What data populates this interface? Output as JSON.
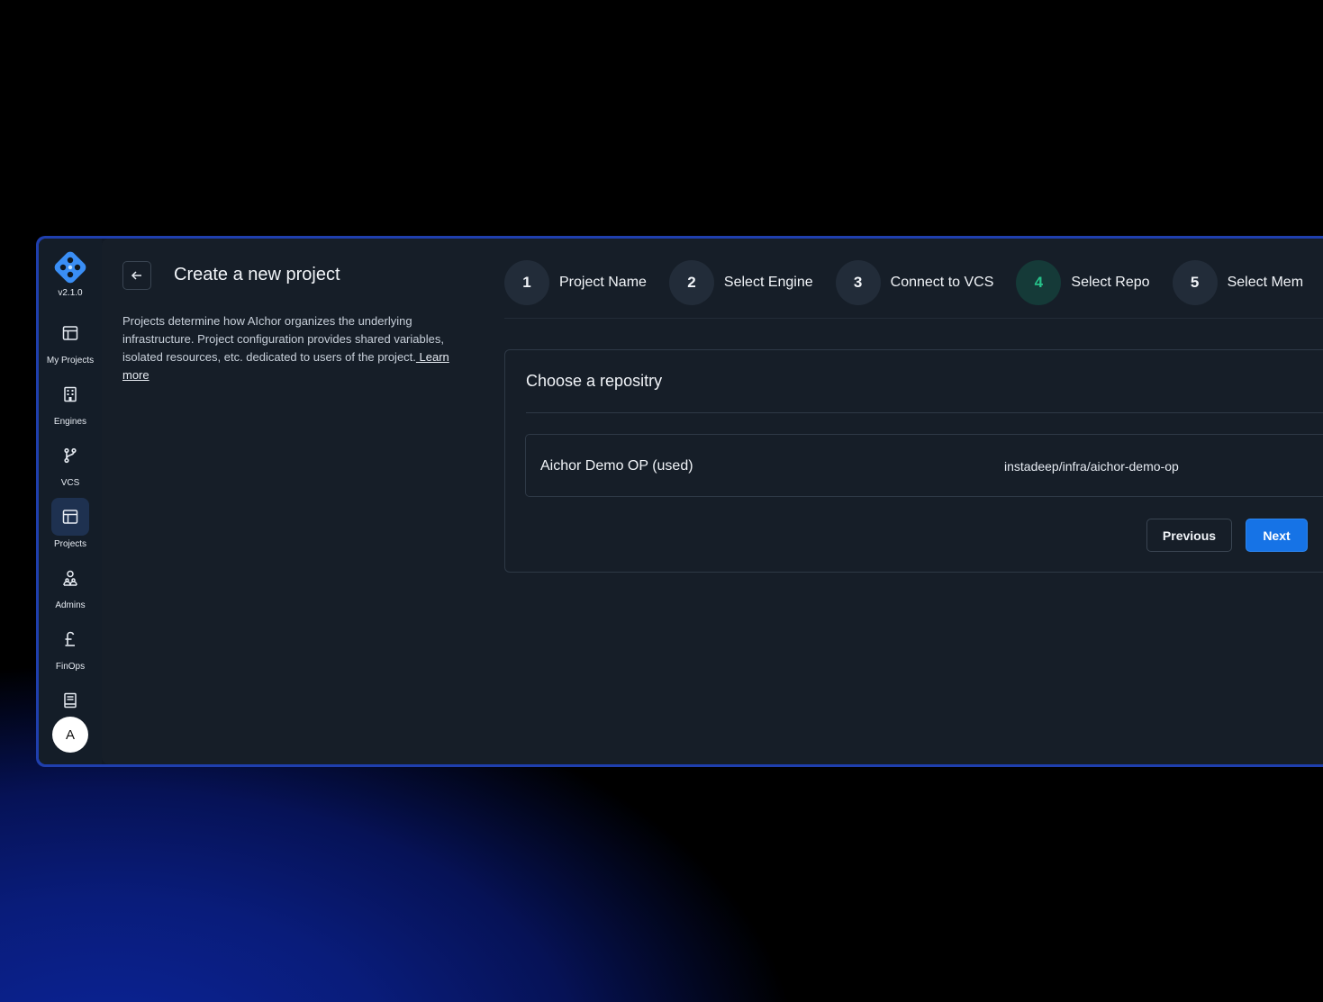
{
  "app": {
    "version": "v2.1.0"
  },
  "sidebar": {
    "items": [
      {
        "label": "My Projects",
        "icon": "layout-icon",
        "active": false
      },
      {
        "label": "Engines",
        "icon": "building-icon",
        "active": false
      },
      {
        "label": "VCS",
        "icon": "git-branch-icon",
        "active": false
      },
      {
        "label": "Projects",
        "icon": "layout-icon",
        "active": true
      },
      {
        "label": "Admins",
        "icon": "admins-icon",
        "active": false
      },
      {
        "label": "FinOps",
        "icon": "pound-icon",
        "active": false
      },
      {
        "label": "",
        "icon": "book-icon",
        "active": false
      }
    ],
    "avatar_initial": "A"
  },
  "header": {
    "title": "Create a new project",
    "description": "Projects determine how AIchor organizes the underlying infrastructure.  Project configuration provides shared variables, isolated resources,  etc. dedicated to users of the project.",
    "learn_more": " Learn more"
  },
  "stepper": {
    "steps": [
      {
        "number": "1",
        "label": "Project Name",
        "active": false
      },
      {
        "number": "2",
        "label": "Select Engine",
        "active": false
      },
      {
        "number": "3",
        "label": "Connect to VCS",
        "active": false
      },
      {
        "number": "4",
        "label": "Select Repo",
        "active": true
      },
      {
        "number": "5",
        "label": "Select Mem",
        "active": false
      }
    ]
  },
  "card": {
    "title": "Choose a repositry",
    "repos": [
      {
        "name": "Aichor Demo OP (used)",
        "path": "instadeep/infra/aichor-demo-op"
      }
    ],
    "previous_label": "Previous",
    "next_label": "Next"
  },
  "colors": {
    "accent": "#1673e6",
    "active_step": "#27c28a",
    "frame_border": "#1f3fae"
  }
}
